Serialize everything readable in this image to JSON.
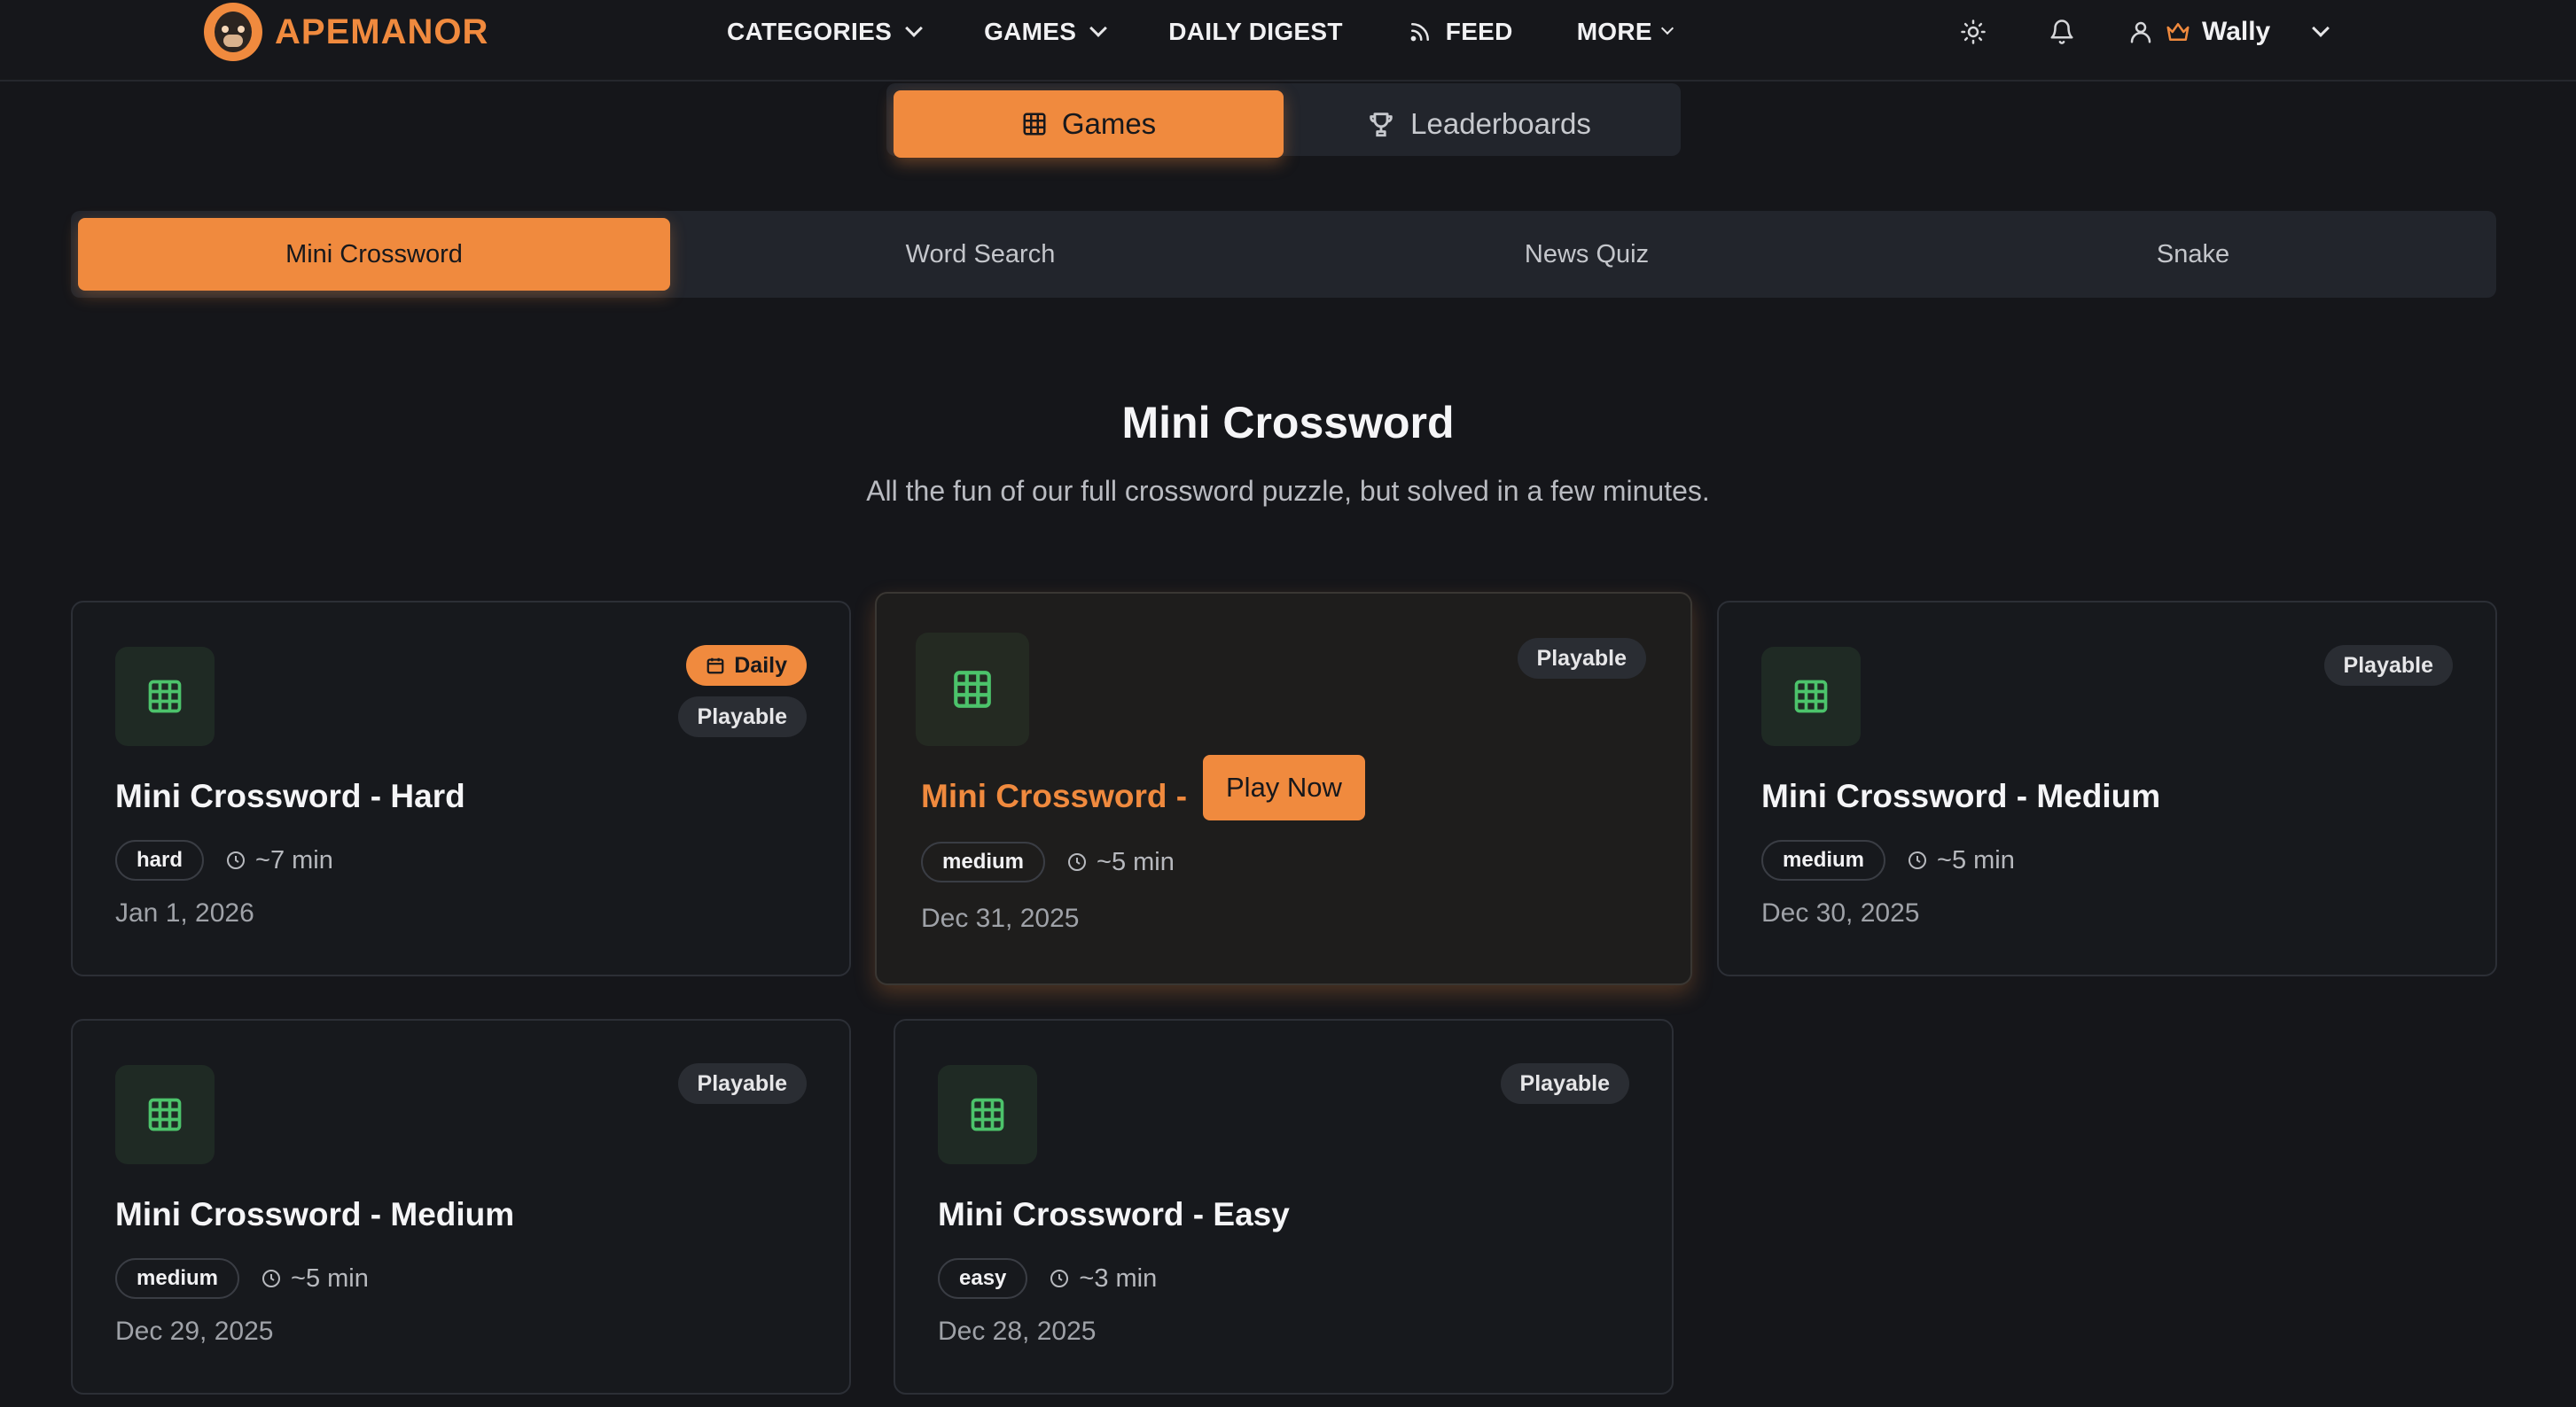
{
  "brand": {
    "name": "APEMANOR"
  },
  "nav": {
    "categories": "CATEGORIES",
    "games": "GAMES",
    "daily_digest": "DAILY DIGEST",
    "feed": "FEED",
    "more": "MORE"
  },
  "user": {
    "name": "Wally"
  },
  "main_toggle": {
    "games": "Games",
    "leaderboards": "Leaderboards"
  },
  "game_tabs": [
    "Mini Crossword",
    "Word Search",
    "News Quiz",
    "Snake"
  ],
  "page": {
    "title": "Mini Crossword",
    "subtitle": "All the fun of our full crossword puzzle, but solved in a few minutes."
  },
  "cards": [
    {
      "title": "Mini Crossword - Hard",
      "difficulty": "hard",
      "time": "~7 min",
      "date": "Jan 1, 2026",
      "daily": "Daily",
      "status": "Playable"
    },
    {
      "title": "Mini Crossword -",
      "difficulty": "medium",
      "time": "~5 min",
      "date": "Dec 31, 2025",
      "status": "Playable",
      "hover_button": "Play Now"
    },
    {
      "title": "Mini Crossword - Medium",
      "difficulty": "medium",
      "time": "~5 min",
      "date": "Dec 30, 2025",
      "status": "Playable"
    },
    {
      "title": "Mini Crossword - Medium",
      "difficulty": "medium",
      "time": "~5 min",
      "date": "Dec 29, 2025",
      "status": "Playable"
    },
    {
      "title": "Mini Crossword - Easy",
      "difficulty": "easy",
      "time": "~3 min",
      "date": "Dec 28, 2025",
      "status": "Playable"
    }
  ],
  "colors": {
    "accent": "#f08a3e",
    "background": "#15161a",
    "card": "#17191d",
    "icon_green": "#4cc36b"
  }
}
